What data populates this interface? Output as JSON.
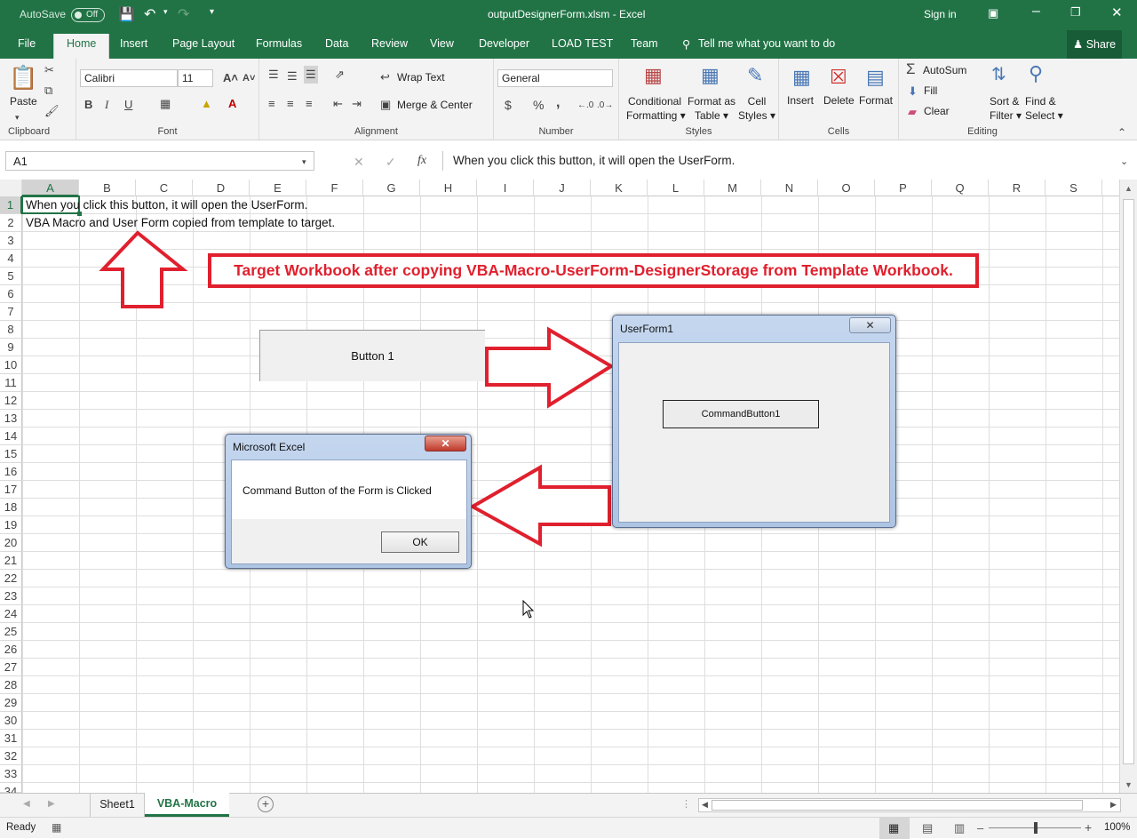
{
  "titlebar": {
    "autosave": "AutoSave",
    "autosave_state": "Off",
    "filename": "outputDesignerForm.xlsm  -  Excel",
    "signin": "Sign in"
  },
  "tabs": [
    "File",
    "Home",
    "Insert",
    "Page Layout",
    "Formulas",
    "Data",
    "Review",
    "View",
    "Developer",
    "LOAD TEST",
    "Team"
  ],
  "tellme": "Tell me what you want to do",
  "share": "Share",
  "ribbon": {
    "paste": "Paste",
    "clipboard": "Clipboard",
    "font_name": "Calibri",
    "font_size": "11",
    "font": "Font",
    "wrap_text": "Wrap Text",
    "merge_center": "Merge & Center",
    "alignment": "Alignment",
    "number_format": "General",
    "number": "Number",
    "currency": "$",
    "percent": "%",
    "comma": ",",
    "cond_fmt_1": "Conditional",
    "cond_fmt_2": "Formatting",
    "fmt_table_1": "Format as",
    "fmt_table_2": "Table",
    "cell_styles_1": "Cell",
    "cell_styles_2": "Styles",
    "styles": "Styles",
    "insert": "Insert",
    "delete": "Delete",
    "format": "Format",
    "cells": "Cells",
    "autosum": "AutoSum",
    "fill": "Fill",
    "clear": "Clear",
    "sort_1": "Sort &",
    "sort_2": "Filter",
    "find_1": "Find &",
    "find_2": "Select",
    "editing": "Editing",
    "bold": "B",
    "italic": "I",
    "underline": "U"
  },
  "formula": {
    "namebox": "A1",
    "fx": "fx",
    "content": "When you click this button, it will open the UserForm."
  },
  "columns": [
    "A",
    "B",
    "C",
    "D",
    "E",
    "F",
    "G",
    "H",
    "I",
    "J",
    "K",
    "L",
    "M",
    "N",
    "O",
    "P",
    "Q",
    "R",
    "S"
  ],
  "rows": [
    "1",
    "2",
    "3",
    "4",
    "5",
    "6",
    "7",
    "8",
    "9",
    "10",
    "11",
    "12",
    "13",
    "14",
    "15",
    "16",
    "17",
    "18",
    "19",
    "20",
    "21",
    "22",
    "23",
    "24",
    "25",
    "26",
    "27",
    "28",
    "29",
    "30",
    "31",
    "32",
    "33",
    "34"
  ],
  "cells": {
    "a1": "When you click this button, it will open the UserForm.",
    "a2": "VBA Macro and User Form copied from template to target."
  },
  "annotation": "Target Workbook after copying VBA-Macro-UserForm-DesignerStorage from Template Workbook.",
  "button1": "Button 1",
  "userform": {
    "title": "UserForm1",
    "button": "CommandButton1"
  },
  "msgbox": {
    "title": "Microsoft Excel",
    "message": "Command Button of the Form is Clicked",
    "ok": "OK"
  },
  "sheets": [
    "Sheet1",
    "VBA-Macro"
  ],
  "status": {
    "ready": "Ready",
    "zoom": "100%"
  },
  "colors": {
    "excel_green": "#217346",
    "arrow_red": "#e0202e"
  }
}
